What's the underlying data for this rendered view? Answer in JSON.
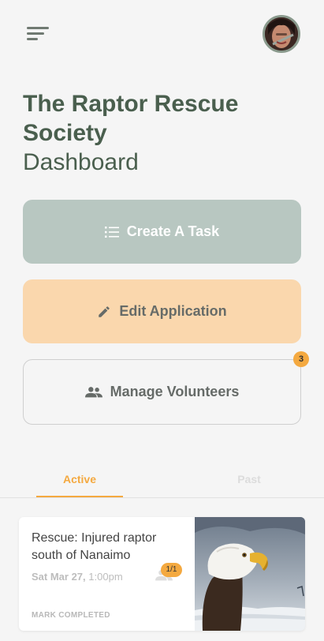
{
  "header": {
    "menu_icon": "menu-icon",
    "avatar": "user-avatar"
  },
  "title": {
    "org_name": "The Raptor Rescue Society",
    "subtitle": "Dashboard"
  },
  "actions": {
    "create_task": {
      "label": "Create A Task",
      "icon": "list-icon",
      "color": "#b8c7c1"
    },
    "edit_application": {
      "label": "Edit Application",
      "icon": "pencil-icon",
      "color": "#fad7ad"
    },
    "manage_volunteers": {
      "label": "Manage Volunteers",
      "icon": "people-icon",
      "badge": "3"
    }
  },
  "tabs": {
    "active": "Active",
    "past": "Past"
  },
  "task": {
    "title": "Rescue: Injured raptor south of Nanaimo",
    "date": "Sat Mar 27,",
    "time": "1:00pm",
    "count": "1/1",
    "action": "MARK COMPLETED",
    "image": "bald-eagle-photo"
  },
  "colors": {
    "brand_green": "#4a5f4e",
    "accent_orange": "#f4a940"
  }
}
